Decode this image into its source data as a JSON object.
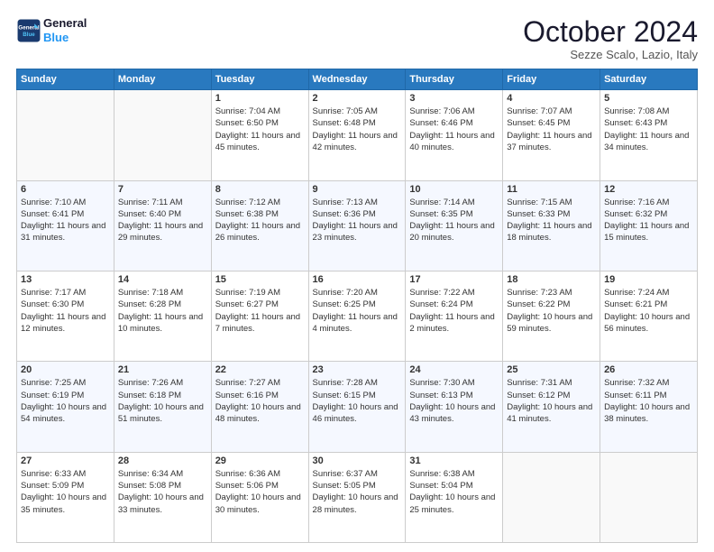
{
  "header": {
    "logo_line1": "General",
    "logo_line2": "Blue",
    "month": "October 2024",
    "location": "Sezze Scalo, Lazio, Italy"
  },
  "days_of_week": [
    "Sunday",
    "Monday",
    "Tuesday",
    "Wednesday",
    "Thursday",
    "Friday",
    "Saturday"
  ],
  "weeks": [
    [
      {
        "day": "",
        "sunrise": "",
        "sunset": "",
        "daylight": ""
      },
      {
        "day": "",
        "sunrise": "",
        "sunset": "",
        "daylight": ""
      },
      {
        "day": "1",
        "sunrise": "Sunrise: 7:04 AM",
        "sunset": "Sunset: 6:50 PM",
        "daylight": "Daylight: 11 hours and 45 minutes."
      },
      {
        "day": "2",
        "sunrise": "Sunrise: 7:05 AM",
        "sunset": "Sunset: 6:48 PM",
        "daylight": "Daylight: 11 hours and 42 minutes."
      },
      {
        "day": "3",
        "sunrise": "Sunrise: 7:06 AM",
        "sunset": "Sunset: 6:46 PM",
        "daylight": "Daylight: 11 hours and 40 minutes."
      },
      {
        "day": "4",
        "sunrise": "Sunrise: 7:07 AM",
        "sunset": "Sunset: 6:45 PM",
        "daylight": "Daylight: 11 hours and 37 minutes."
      },
      {
        "day": "5",
        "sunrise": "Sunrise: 7:08 AM",
        "sunset": "Sunset: 6:43 PM",
        "daylight": "Daylight: 11 hours and 34 minutes."
      }
    ],
    [
      {
        "day": "6",
        "sunrise": "Sunrise: 7:10 AM",
        "sunset": "Sunset: 6:41 PM",
        "daylight": "Daylight: 11 hours and 31 minutes."
      },
      {
        "day": "7",
        "sunrise": "Sunrise: 7:11 AM",
        "sunset": "Sunset: 6:40 PM",
        "daylight": "Daylight: 11 hours and 29 minutes."
      },
      {
        "day": "8",
        "sunrise": "Sunrise: 7:12 AM",
        "sunset": "Sunset: 6:38 PM",
        "daylight": "Daylight: 11 hours and 26 minutes."
      },
      {
        "day": "9",
        "sunrise": "Sunrise: 7:13 AM",
        "sunset": "Sunset: 6:36 PM",
        "daylight": "Daylight: 11 hours and 23 minutes."
      },
      {
        "day": "10",
        "sunrise": "Sunrise: 7:14 AM",
        "sunset": "Sunset: 6:35 PM",
        "daylight": "Daylight: 11 hours and 20 minutes."
      },
      {
        "day": "11",
        "sunrise": "Sunrise: 7:15 AM",
        "sunset": "Sunset: 6:33 PM",
        "daylight": "Daylight: 11 hours and 18 minutes."
      },
      {
        "day": "12",
        "sunrise": "Sunrise: 7:16 AM",
        "sunset": "Sunset: 6:32 PM",
        "daylight": "Daylight: 11 hours and 15 minutes."
      }
    ],
    [
      {
        "day": "13",
        "sunrise": "Sunrise: 7:17 AM",
        "sunset": "Sunset: 6:30 PM",
        "daylight": "Daylight: 11 hours and 12 minutes."
      },
      {
        "day": "14",
        "sunrise": "Sunrise: 7:18 AM",
        "sunset": "Sunset: 6:28 PM",
        "daylight": "Daylight: 11 hours and 10 minutes."
      },
      {
        "day": "15",
        "sunrise": "Sunrise: 7:19 AM",
        "sunset": "Sunset: 6:27 PM",
        "daylight": "Daylight: 11 hours and 7 minutes."
      },
      {
        "day": "16",
        "sunrise": "Sunrise: 7:20 AM",
        "sunset": "Sunset: 6:25 PM",
        "daylight": "Daylight: 11 hours and 4 minutes."
      },
      {
        "day": "17",
        "sunrise": "Sunrise: 7:22 AM",
        "sunset": "Sunset: 6:24 PM",
        "daylight": "Daylight: 11 hours and 2 minutes."
      },
      {
        "day": "18",
        "sunrise": "Sunrise: 7:23 AM",
        "sunset": "Sunset: 6:22 PM",
        "daylight": "Daylight: 10 hours and 59 minutes."
      },
      {
        "day": "19",
        "sunrise": "Sunrise: 7:24 AM",
        "sunset": "Sunset: 6:21 PM",
        "daylight": "Daylight: 10 hours and 56 minutes."
      }
    ],
    [
      {
        "day": "20",
        "sunrise": "Sunrise: 7:25 AM",
        "sunset": "Sunset: 6:19 PM",
        "daylight": "Daylight: 10 hours and 54 minutes."
      },
      {
        "day": "21",
        "sunrise": "Sunrise: 7:26 AM",
        "sunset": "Sunset: 6:18 PM",
        "daylight": "Daylight: 10 hours and 51 minutes."
      },
      {
        "day": "22",
        "sunrise": "Sunrise: 7:27 AM",
        "sunset": "Sunset: 6:16 PM",
        "daylight": "Daylight: 10 hours and 48 minutes."
      },
      {
        "day": "23",
        "sunrise": "Sunrise: 7:28 AM",
        "sunset": "Sunset: 6:15 PM",
        "daylight": "Daylight: 10 hours and 46 minutes."
      },
      {
        "day": "24",
        "sunrise": "Sunrise: 7:30 AM",
        "sunset": "Sunset: 6:13 PM",
        "daylight": "Daylight: 10 hours and 43 minutes."
      },
      {
        "day": "25",
        "sunrise": "Sunrise: 7:31 AM",
        "sunset": "Sunset: 6:12 PM",
        "daylight": "Daylight: 10 hours and 41 minutes."
      },
      {
        "day": "26",
        "sunrise": "Sunrise: 7:32 AM",
        "sunset": "Sunset: 6:11 PM",
        "daylight": "Daylight: 10 hours and 38 minutes."
      }
    ],
    [
      {
        "day": "27",
        "sunrise": "Sunrise: 6:33 AM",
        "sunset": "Sunset: 5:09 PM",
        "daylight": "Daylight: 10 hours and 35 minutes."
      },
      {
        "day": "28",
        "sunrise": "Sunrise: 6:34 AM",
        "sunset": "Sunset: 5:08 PM",
        "daylight": "Daylight: 10 hours and 33 minutes."
      },
      {
        "day": "29",
        "sunrise": "Sunrise: 6:36 AM",
        "sunset": "Sunset: 5:06 PM",
        "daylight": "Daylight: 10 hours and 30 minutes."
      },
      {
        "day": "30",
        "sunrise": "Sunrise: 6:37 AM",
        "sunset": "Sunset: 5:05 PM",
        "daylight": "Daylight: 10 hours and 28 minutes."
      },
      {
        "day": "31",
        "sunrise": "Sunrise: 6:38 AM",
        "sunset": "Sunset: 5:04 PM",
        "daylight": "Daylight: 10 hours and 25 minutes."
      },
      {
        "day": "",
        "sunrise": "",
        "sunset": "",
        "daylight": ""
      },
      {
        "day": "",
        "sunrise": "",
        "sunset": "",
        "daylight": ""
      }
    ]
  ]
}
